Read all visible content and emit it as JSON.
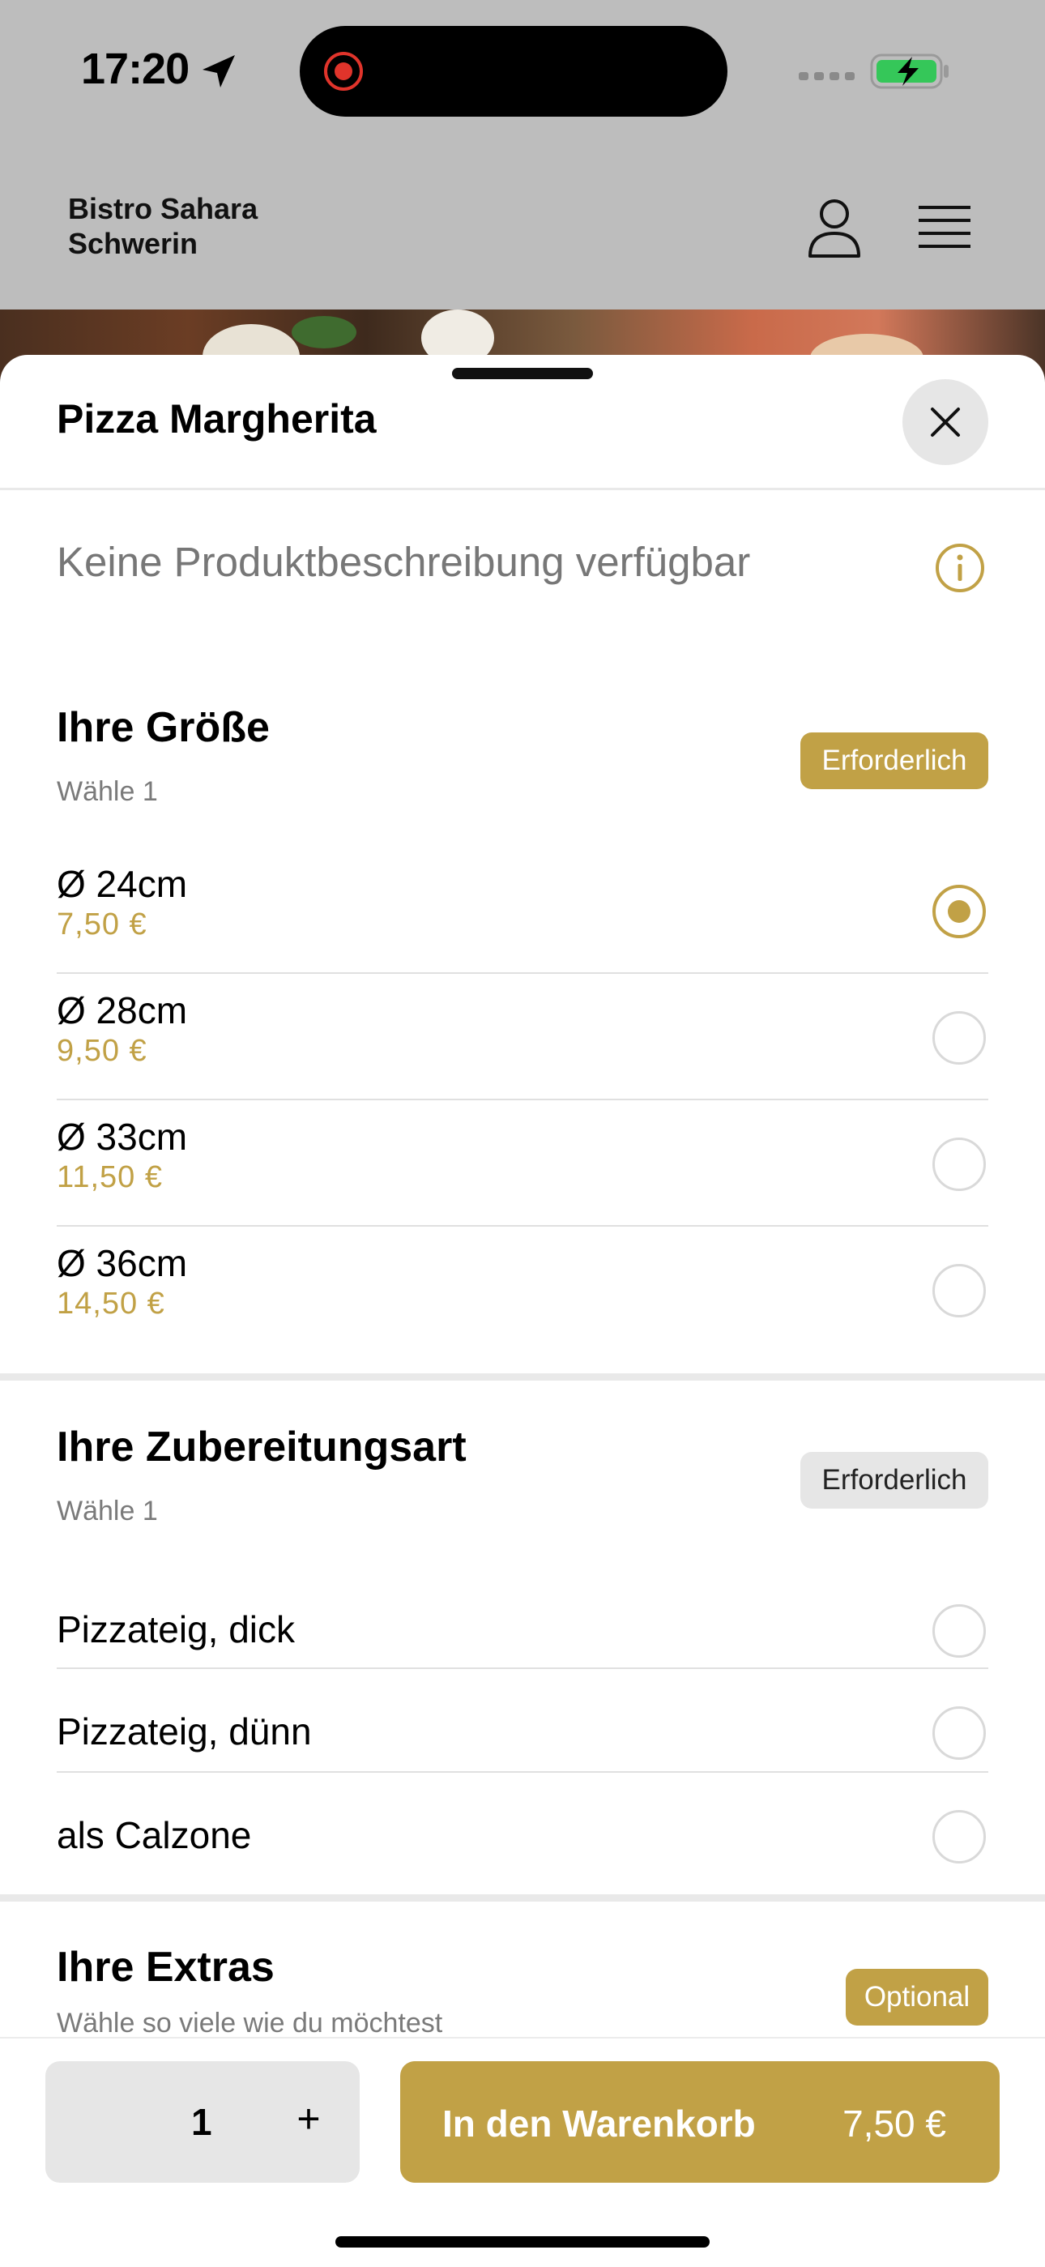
{
  "status_bar": {
    "time": "17:20"
  },
  "header": {
    "brand_line1": "Bistro Sahara",
    "brand_line2": "Schwerin"
  },
  "sheet": {
    "title": "Pizza Margherita",
    "description": "Keine Produktbeschreibung verfügbar"
  },
  "size_section": {
    "title": "Ihre Größe",
    "subtitle": "Wähle 1",
    "badge": "Erforderlich",
    "options": [
      {
        "label": "Ø 24cm",
        "price": "7,50 €",
        "selected": true
      },
      {
        "label": "Ø 28cm",
        "price": "9,50 €",
        "selected": false
      },
      {
        "label": "Ø 33cm",
        "price": "11,50 €",
        "selected": false
      },
      {
        "label": "Ø 36cm",
        "price": "14,50 €",
        "selected": false
      }
    ]
  },
  "prep_section": {
    "title": "Ihre Zubereitungsart",
    "subtitle": "Wähle 1",
    "badge": "Erforderlich",
    "options": [
      {
        "label": "Pizzateig, dick",
        "selected": false
      },
      {
        "label": "Pizzateig, dünn",
        "selected": false
      },
      {
        "label": "als Calzone",
        "selected": false
      }
    ]
  },
  "extras_section": {
    "title": "Ihre Extras",
    "subtitle": "Wähle so viele wie du möchtest",
    "badge": "Optional"
  },
  "bottom_bar": {
    "quantity": "1",
    "plus": "+",
    "cart_label": "In den Warenkorb",
    "cart_price": "7,50 €"
  },
  "colors": {
    "accent": "#c1a146",
    "badge_gray": "#e6e6e6",
    "muted_text": "#777777"
  }
}
